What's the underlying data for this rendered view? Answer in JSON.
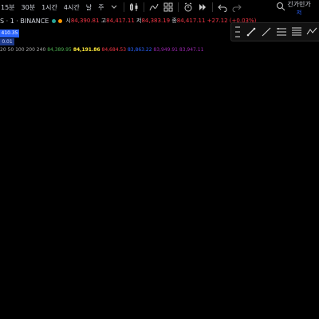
{
  "toolbar": {
    "timeframes": [
      "15분",
      "30분",
      "1시간",
      "4시간",
      "날",
      "주"
    ],
    "right_label": "긴가민가",
    "right_sub": "저"
  },
  "symbol": {
    "title": "S · 1 · BINANCE",
    "open_label": "시",
    "open": "84,390.81",
    "high_label": "고",
    "high": "84,417.11",
    "low_label": "저",
    "low": "84,383.19",
    "close_label": "종",
    "close": "84,417.11",
    "change": "+27.12 (+0.03%)",
    "price_badge": "410.35",
    "sub_badge": "0.01"
  },
  "moving_averages": {
    "periods": "20 50 100 200 240",
    "values": [
      {
        "value": "84,389.95",
        "color": "#4caf50"
      },
      {
        "value": "84,191.86",
        "color": "#ffeb3b"
      },
      {
        "value": "84,684.53",
        "color": "#f23645"
      },
      {
        "value": "83,863.22",
        "color": "#2962ff"
      },
      {
        "value": "83,949.91",
        "color": "#9c27b0"
      },
      {
        "value": "83,947.11",
        "color": "#9c27b0"
      }
    ]
  },
  "colors": {
    "up": "#f23645",
    "down": "#2962ff",
    "background": "#000000",
    "zone_red": "#5a1a1a",
    "zone_green": "#0f3a30",
    "ma_green": "#4caf50",
    "ma_yellow": "#c9b23a",
    "ma_red": "#b22222",
    "ma_blue": "#2962ff"
  },
  "icons": [
    "candlestick-icon",
    "indicator-icon",
    "template-icon",
    "alert-icon",
    "replay-icon",
    "undo-icon",
    "redo-icon"
  ],
  "draw_tools": [
    "pencil-icon",
    "trendline-icon",
    "long-short-icon",
    "fibonacci-icon",
    "brush-icon",
    "more-icon"
  ]
}
